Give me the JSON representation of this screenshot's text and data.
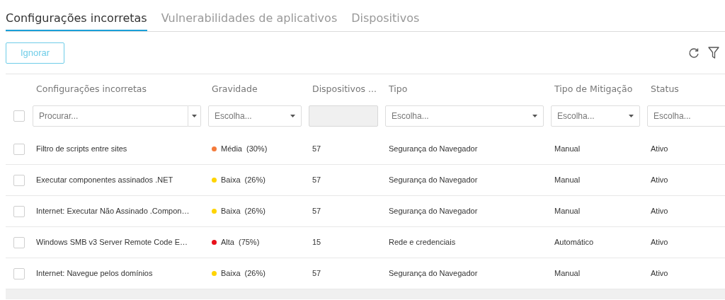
{
  "tabs": [
    {
      "label": "Configurações incorretas",
      "selected": true
    },
    {
      "label": "Vulnerabilidades de aplicativos",
      "selected": false
    },
    {
      "label": "Dispositivos",
      "selected": false
    }
  ],
  "toolbar": {
    "ignore_button": "Ignorar"
  },
  "table": {
    "columns": [
      {
        "label": "Configurações incorretas",
        "filter": {
          "kind": "search",
          "placeholder": "Procurar..."
        }
      },
      {
        "label": "Gravidade",
        "filter": {
          "kind": "select",
          "placeholder": "Escolha..."
        }
      },
      {
        "label": "Dispositivos ...",
        "filter": {
          "kind": "disabled"
        }
      },
      {
        "label": "Tipo",
        "filter": {
          "kind": "select",
          "placeholder": "Escolha..."
        }
      },
      {
        "label": "Tipo de Mitigação",
        "filter": {
          "kind": "select",
          "placeholder": "Escolha..."
        }
      },
      {
        "label": "Status",
        "filter": {
          "kind": "cut",
          "placeholder": "Escolha..."
        }
      }
    ],
    "select_all_checked": false,
    "rows": [
      {
        "checked": false,
        "name": "Filtro de scripts entre sites",
        "severity": "Média",
        "severity_pct": "(30%)",
        "color": "#f47b3b",
        "devices": "57",
        "type": "Segurança do Navegador",
        "mitigation": "Manual",
        "status": "Ativo"
      },
      {
        "checked": false,
        "name": "Executar componentes assinados .NET",
        "severity": "Baixa",
        "severity_pct": "(26%)",
        "color": "#ffd400",
        "devices": "57",
        "type": "Segurança do Navegador",
        "mitigation": "Manual",
        "status": "Ativo"
      },
      {
        "checked": false,
        "name": "Internet: Executar Não Assinado .Compon…",
        "severity": "Baixa",
        "severity_pct": "(26%)",
        "color": "#ffd400",
        "devices": "57",
        "type": "Segurança do Navegador",
        "mitigation": "Manual",
        "status": "Ativo"
      },
      {
        "checked": false,
        "name": "Windows SMB v3 Server Remote Code E…",
        "severity": "Alta",
        "severity_pct": "(75%)",
        "color": "#e8101a",
        "devices": "15",
        "type": "Rede e credenciais",
        "mitigation": "Automático",
        "status": "Ativo"
      },
      {
        "checked": false,
        "name": "Internet: Navegue pelos domínios",
        "severity": "Baixa",
        "severity_pct": "(26%)",
        "color": "#ffd400",
        "devices": "57",
        "type": "Segurança do Navegador",
        "mitigation": "Manual",
        "status": "Ativo"
      }
    ]
  }
}
